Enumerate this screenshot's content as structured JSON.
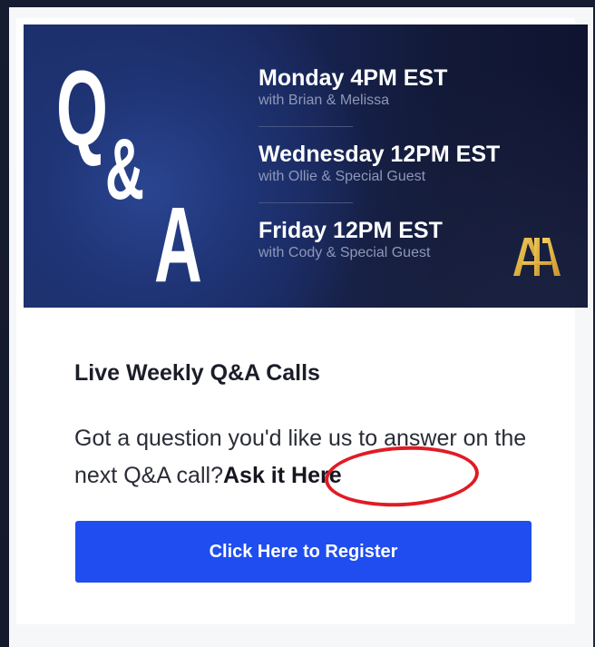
{
  "banner": {
    "logo_text": {
      "q": "Q",
      "amp": "&",
      "a": "A"
    },
    "schedule": [
      {
        "day": "Monday 4PM EST",
        "with": "with Brian & Melissa"
      },
      {
        "day": "Wednesday 12PM EST",
        "with": "with Ollie & Special Guest"
      },
      {
        "day": "Friday 12PM EST",
        "with": "with Cody & Special Guest"
      }
    ],
    "brand_logo_icon": "aia-gold-monogram-icon",
    "brand_gold": "#e3b23c"
  },
  "content": {
    "title": "Live Weekly Q&A Calls",
    "description_text": "Got a question you'd like us to answer on the next Q&A call?",
    "ask_link_label": "Ask it Here",
    "register_label": "Click Here to Register"
  },
  "colors": {
    "accent_button": "#1f4df0",
    "highlight_ring": "#e01b24"
  }
}
